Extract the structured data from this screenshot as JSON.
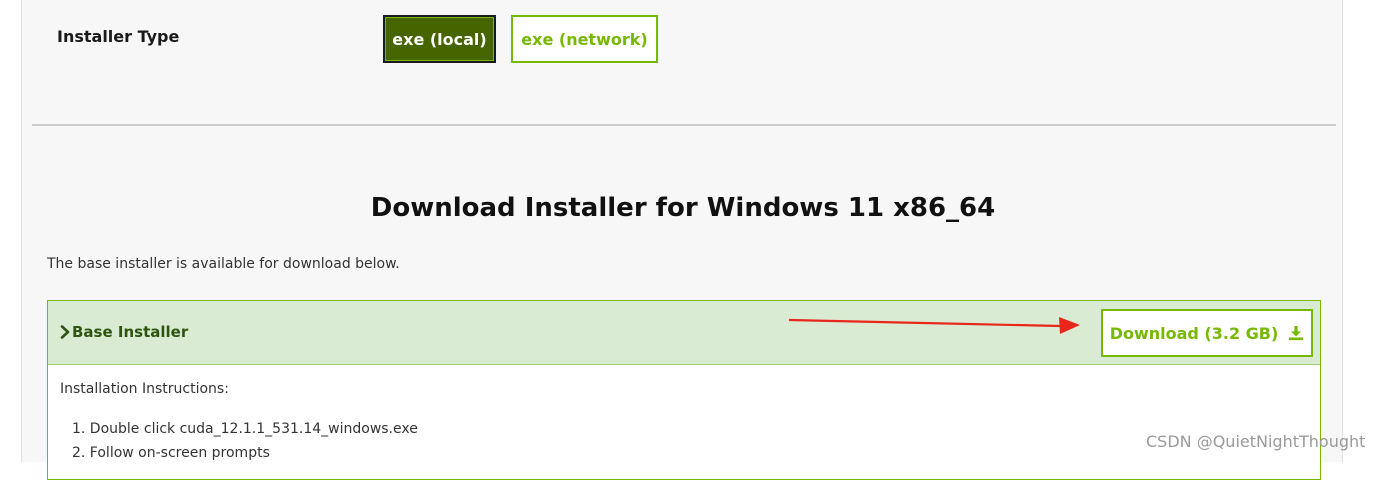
{
  "installer_type": {
    "label": "Installer Type",
    "options": [
      {
        "label": "exe (local)",
        "selected": true
      },
      {
        "label": "exe (network)",
        "selected": false
      }
    ]
  },
  "section": {
    "title": "Download Installer for Windows 11 x86_64",
    "description": "The base installer is available for download below."
  },
  "base_installer": {
    "title": "Base Installer",
    "download_label": "Download (3.2 GB)",
    "instructions_label": "Installation Instructions:",
    "steps": [
      "1. Double click cuda_12.1.1_531.14_windows.exe",
      "2. Follow on-screen prompts"
    ]
  },
  "watermark": "CSDN @QuietNightThought",
  "colors": {
    "accent": "#76b900",
    "selected_bg": "#466500",
    "header_bg": "#d9ecd3",
    "annotation_arrow": "#e8261b"
  },
  "icons": [
    "chevron-right-icon",
    "download-icon"
  ]
}
